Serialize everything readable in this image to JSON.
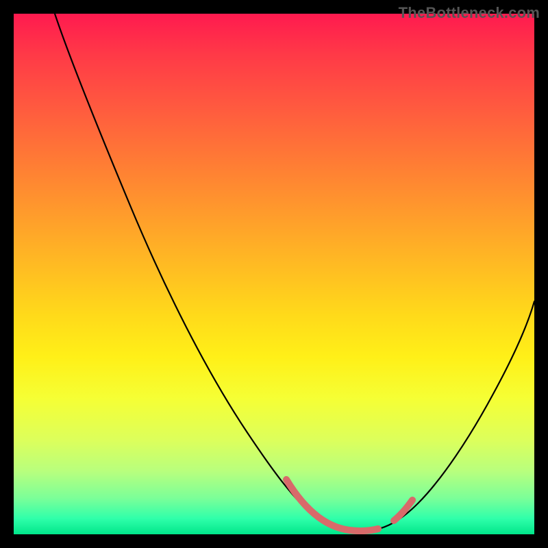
{
  "watermark": "TheBottleneck.com",
  "chart_data": {
    "type": "line",
    "title": "",
    "xlabel": "",
    "ylabel": "",
    "xlim": [
      0,
      100
    ],
    "ylim": [
      0,
      100
    ],
    "grid": false,
    "legend": false,
    "series": [
      {
        "name": "bottleneck-curve",
        "color": "#000000",
        "x": [
          8,
          12,
          16,
          20,
          24,
          28,
          32,
          36,
          40,
          44,
          48,
          52,
          55,
          57,
          60,
          63,
          66,
          69,
          72,
          76,
          80,
          84,
          88,
          92,
          96,
          100
        ],
        "y": [
          100,
          92,
          84,
          76,
          68,
          60,
          52,
          44,
          36,
          28,
          21,
          14,
          9,
          6,
          4,
          3,
          2.5,
          2.5,
          3,
          5,
          9,
          15,
          22,
          30,
          38,
          46
        ]
      },
      {
        "name": "sweet-spot-marker",
        "color": "#d86a6a",
        "x": [
          53,
          55,
          57,
          59,
          61,
          63,
          65,
          67,
          69,
          72,
          74
        ],
        "y": [
          10,
          7.5,
          5.5,
          4.2,
          3.4,
          3.0,
          2.8,
          2.8,
          3.2,
          4.6,
          6.2
        ]
      }
    ],
    "gradient_stops": [
      {
        "pos": 0,
        "color": "#ff1a4f"
      },
      {
        "pos": 8,
        "color": "#ff3a47"
      },
      {
        "pos": 18,
        "color": "#ff5a3f"
      },
      {
        "pos": 28,
        "color": "#ff7a35"
      },
      {
        "pos": 38,
        "color": "#ff9a2c"
      },
      {
        "pos": 48,
        "color": "#ffba23"
      },
      {
        "pos": 58,
        "color": "#ffda1a"
      },
      {
        "pos": 66,
        "color": "#fff018"
      },
      {
        "pos": 74,
        "color": "#f5ff35"
      },
      {
        "pos": 82,
        "color": "#dcff5c"
      },
      {
        "pos": 88,
        "color": "#b7ff7e"
      },
      {
        "pos": 93,
        "color": "#7cff98"
      },
      {
        "pos": 97,
        "color": "#2fffaa"
      },
      {
        "pos": 100,
        "color": "#00e68a"
      }
    ]
  }
}
